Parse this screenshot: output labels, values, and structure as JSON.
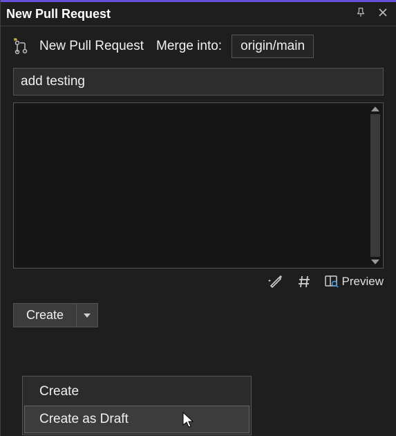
{
  "titleBar": {
    "title": "New Pull Request"
  },
  "header": {
    "label": "New Pull Request",
    "mergeLabel": "Merge into:",
    "targetBranch": "origin/main"
  },
  "form": {
    "title": "add testing",
    "description": ""
  },
  "toolbar": {
    "preview": "Preview"
  },
  "splitButton": {
    "main": "Create"
  },
  "menu": {
    "items": [
      {
        "label": "Create",
        "highlighted": false
      },
      {
        "label": "Create as Draft",
        "highlighted": true
      }
    ]
  }
}
